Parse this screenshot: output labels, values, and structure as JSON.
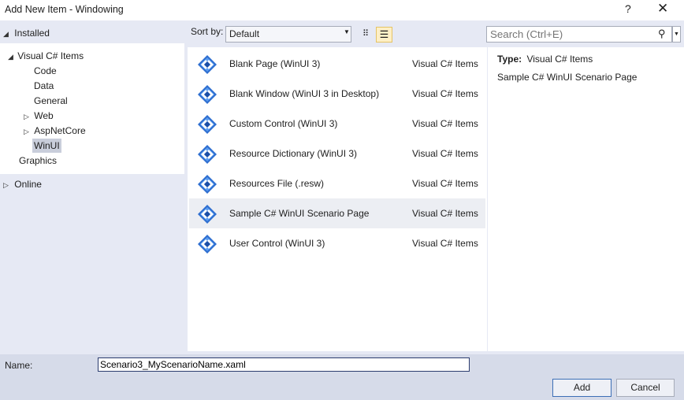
{
  "window": {
    "title": "Add New Item - Windowing",
    "help": "?",
    "close": "✕"
  },
  "tree": {
    "installed": "Installed",
    "items": [
      {
        "label": "Visual C# Items"
      },
      {
        "label": "Code"
      },
      {
        "label": "Data"
      },
      {
        "label": "General"
      },
      {
        "label": "Web"
      },
      {
        "label": "AspNetCore"
      },
      {
        "label": "WinUI",
        "selected": true
      },
      {
        "label": "Graphics"
      }
    ],
    "online": "Online"
  },
  "toolbar": {
    "sort_label": "Sort by:",
    "sort_value": "Default",
    "search_placeholder": "Search (Ctrl+E)"
  },
  "templates": [
    {
      "name": "Blank Page (WinUI 3)",
      "type": "Visual C# Items"
    },
    {
      "name": "Blank Window (WinUI 3 in Desktop)",
      "type": "Visual C# Items"
    },
    {
      "name": "Custom Control (WinUI 3)",
      "type": "Visual C# Items"
    },
    {
      "name": "Resource Dictionary (WinUI 3)",
      "type": "Visual C# Items"
    },
    {
      "name": "Resources File (.resw)",
      "type": "Visual C# Items"
    },
    {
      "name": "Sample C# WinUI Scenario Page",
      "type": "Visual C# Items",
      "selected": true
    },
    {
      "name": "User Control (WinUI 3)",
      "type": "Visual C# Items"
    }
  ],
  "details": {
    "type_label": "Type:",
    "type_value": "Visual C# Items",
    "description": "Sample C# WinUI Scenario Page"
  },
  "footer": {
    "name_label": "Name:",
    "name_value": "Scenario3_MyScenarioName.xaml",
    "add": "Add",
    "cancel": "Cancel"
  },
  "colors": {
    "accent": "#3d6fb6",
    "selection": "#c9cedb",
    "panel": "#e6e9f4"
  }
}
